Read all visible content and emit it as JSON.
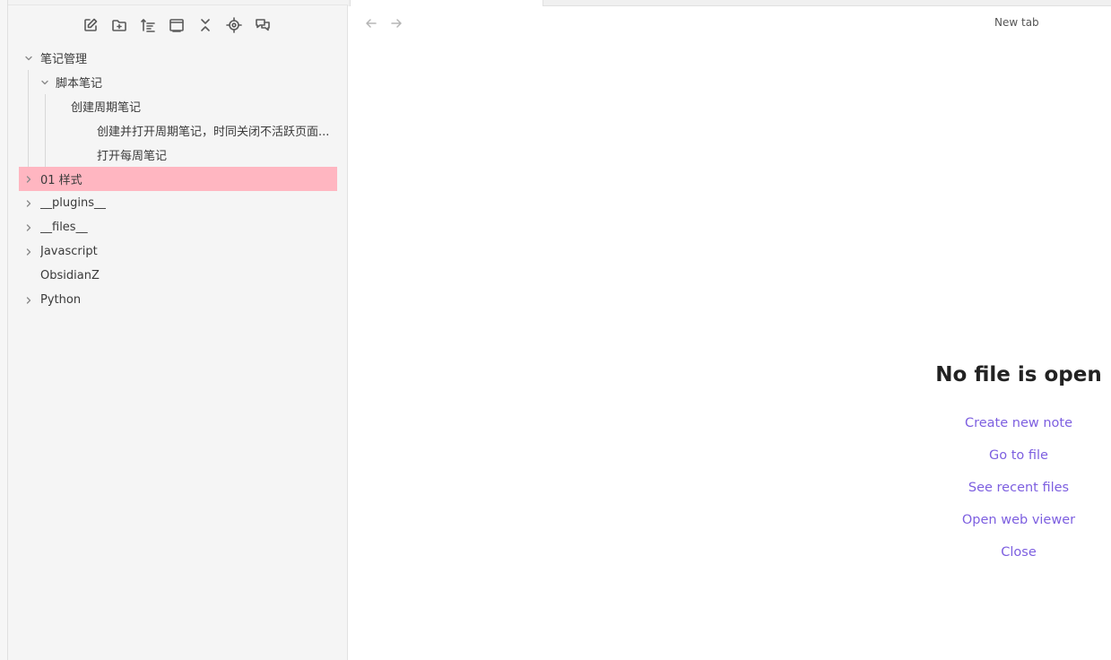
{
  "sidebar": {
    "toolbar": [
      {
        "icon": "new-note-icon"
      },
      {
        "icon": "new-folder-icon"
      },
      {
        "icon": "sort-icon"
      },
      {
        "icon": "auto-reveal-icon"
      },
      {
        "icon": "collapse-all-icon"
      },
      {
        "icon": "locate-icon"
      },
      {
        "icon": "comments-icon"
      }
    ],
    "tree": [
      {
        "label": "笔记管理",
        "expanded": true
      },
      {
        "label": "脚本笔记",
        "expanded": true
      },
      {
        "label": "创建周期笔记"
      },
      {
        "label": "创建并打开周期笔记，时同关闭不活跃页面..."
      },
      {
        "label": "打开每周笔记"
      },
      {
        "label": "01 样式",
        "selected": true,
        "highlight_color": "#ffb6c1"
      },
      {
        "label": "__plugins__"
      },
      {
        "label": "__files__"
      },
      {
        "label": "Javascript"
      },
      {
        "label": "ObsidianZ"
      },
      {
        "label": "Python"
      }
    ]
  },
  "main": {
    "back_icon": "arrow-left-icon",
    "forward_icon": "arrow-right-icon",
    "view_title": "New tab",
    "empty_state": {
      "title": "No file is open",
      "actions": [
        "Create new note",
        "Go to file",
        "See recent files",
        "Open web viewer",
        "Close"
      ]
    }
  },
  "colors": {
    "accent": "#7d5fe0",
    "selection": "#ffb6c1",
    "sidebar_bg": "#f5f5f5"
  }
}
